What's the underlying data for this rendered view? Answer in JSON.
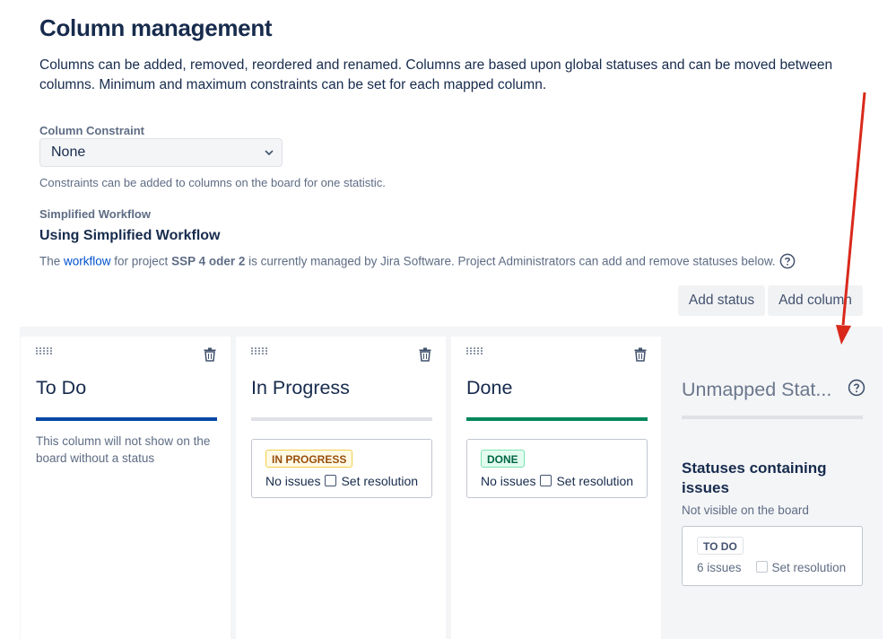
{
  "header": {
    "title": "Column management",
    "description": "Columns can be added, removed, reordered and renamed. Columns are based upon global statuses and can be moved between columns. Minimum and maximum constraints can be set for each mapped column."
  },
  "constraint": {
    "label": "Column Constraint",
    "selected": "None",
    "helper": "Constraints can be added to columns on the board for one statistic."
  },
  "workflow": {
    "label": "Simplified Workflow",
    "title": "Using Simplified Workflow",
    "text_before": "The ",
    "link": "workflow",
    "text_middle": " for project ",
    "project": "SSP 4 oder 2",
    "text_after": " is currently managed by Jira Software. Project Administrators can add and remove statuses below."
  },
  "actions": {
    "add_status": "Add status",
    "add_column": "Add column"
  },
  "columns": [
    {
      "title": "To Do",
      "bar_color": "#0747a6",
      "empty_note": "This column will not show on the board without a status"
    },
    {
      "title": "In Progress",
      "bar_color": "#dfe1e6",
      "status": "IN PROGRESS",
      "status_text_color": "#974f0c",
      "status_border": "#f5cd47",
      "issues": "No issues",
      "resolution_label": "Set resolution"
    },
    {
      "title": "Done",
      "bar_color": "#00875a",
      "status": "DONE",
      "status_text_color": "#006644",
      "status_border": "#79e2b1",
      "issues": "No issues",
      "resolution_label": "Set resolution"
    }
  ],
  "unmapped": {
    "title": "Unmapped Stat...",
    "heading": "Statuses containing issues",
    "note": "Not visible on the board",
    "status": "TO DO",
    "issues": "6 issues",
    "resolution_label": "Set resolution"
  },
  "icons": {
    "drag": "drag-handle-icon",
    "trash": "trash-icon",
    "help": "question-circle-icon",
    "chevron": "chevron-down-icon",
    "annotation_arrow_color": "#d9291b"
  }
}
